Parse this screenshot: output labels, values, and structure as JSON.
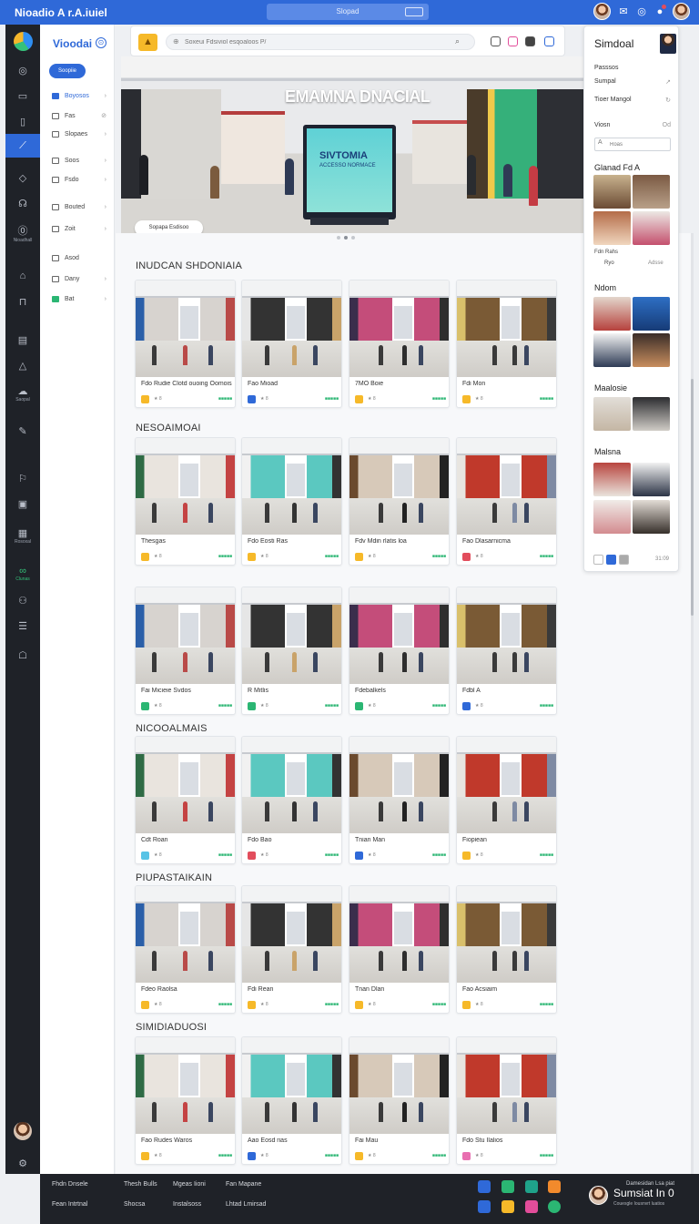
{
  "topbar": {
    "brand": "Nioadio A r.A.iuiel",
    "center_label": "Slopad"
  },
  "nav": {
    "title": "Vioodai",
    "button": "Soopiie",
    "items": [
      {
        "label": "Boyosos",
        "active": true
      },
      {
        "label": "Fas"
      },
      {
        "label": "Slopaes"
      },
      {
        "label": "Soos"
      },
      {
        "label": "Fsdo"
      },
      {
        "label": "Bouted"
      },
      {
        "label": "Zoit"
      },
      {
        "label": "Asod"
      },
      {
        "label": "Dany"
      },
      {
        "label": "Bat"
      }
    ]
  },
  "rail": {
    "labels": [
      "Nioadhall",
      "Saopal",
      "Rosoxal",
      "Clunas"
    ]
  },
  "search": {
    "placeholder": "Soxeui Fdsiviol esqoaloos P/"
  },
  "hero": {
    "headline": "EMAMNA DNACIAL",
    "kiosk_title": "SIVTOMIA",
    "kiosk_sub": "ACCESSO NORMACE",
    "pill": "Sopapa Esdisoo"
  },
  "sections": [
    {
      "title": "INUDCAN SHDONIAIA",
      "cards": [
        {
          "caption": "Fdo Rudie Clotd ouoing Oomoiss",
          "badge": "#f6b929"
        },
        {
          "caption": "Fao Mioad",
          "badge": "#2f69d8"
        },
        {
          "caption": "7MO Boie",
          "badge": "#f6b929"
        },
        {
          "caption": "Fdi Mon",
          "badge": "#f6b929"
        }
      ]
    },
    {
      "title": "NESOAIMOAI",
      "cards": [
        {
          "caption": "Thesgas",
          "badge": "#f6b929"
        },
        {
          "caption": "Fdo Eosti Ras",
          "badge": "#f6b929"
        },
        {
          "caption": "Fdv Mdin rlatis loa",
          "badge": "#f6b929"
        },
        {
          "caption": "Fao Dlasarnicma",
          "badge": "#e24d5c"
        }
      ]
    },
    {
      "title": "",
      "cards": [
        {
          "caption": "Fai Micieie Svdos",
          "badge": "#2bb673"
        },
        {
          "caption": "R Mitlis",
          "badge": "#2bb673"
        },
        {
          "caption": "Fdebalkels",
          "badge": "#2bb673"
        },
        {
          "caption": "Fdbl A",
          "badge": "#2f69d8"
        }
      ]
    },
    {
      "title": "NICOOALMAIS",
      "cards": [
        {
          "caption": "Cdt Roan",
          "badge": "#58c3e6"
        },
        {
          "caption": "Fdo Bao",
          "badge": "#e24d5c"
        },
        {
          "caption": "Tnian Man",
          "badge": "#2f69d8"
        },
        {
          "caption": "Fiopiean",
          "badge": "#f6b929"
        }
      ]
    },
    {
      "title": "PIUPASTAIKAIN",
      "cards": [
        {
          "caption": "Fdeo Raolsa",
          "badge": "#f6b929"
        },
        {
          "caption": "Fdi Rean",
          "badge": "#f6b929"
        },
        {
          "caption": "Tnan Dlan",
          "badge": "#f6b929"
        },
        {
          "caption": "Fao Acsiaim",
          "badge": "#f6b929"
        }
      ]
    },
    {
      "title": "SIMIDIADUOSI",
      "cards": [
        {
          "caption": "Fao Rudes Waros",
          "badge": "#f6b929"
        },
        {
          "caption": "Aao Eosd rias",
          "badge": "#2f69d8"
        },
        {
          "caption": "Fai Mau",
          "badge": "#f6b929"
        },
        {
          "caption": "Fdo Stu Ilalios",
          "badge": "#e86fb0"
        }
      ]
    }
  ],
  "right_panel": {
    "title": "Simdoal",
    "rows": [
      {
        "label": "Passsos",
        "right": ""
      },
      {
        "label": "Sumpal",
        "right": "↗"
      },
      {
        "label": "Tioer Mangol",
        "right": "↻"
      },
      {
        "label": "Viosn",
        "right": "Od"
      }
    ],
    "input_placeholder": "Roas",
    "sections": [
      "Glanad Fd A",
      "Ndom",
      "Maalosie",
      "Malsna"
    ],
    "small_labels": [
      "Fdn Rahs",
      "Ryo",
      "Adsse"
    ],
    "page": "31:09"
  },
  "footer": {
    "col1": [
      "Fhdn Dnsele",
      "Fean Intrtnal"
    ],
    "col2": [
      "Thesh Bulls",
      "Shocsa"
    ],
    "col3": [
      "Mgeas Iioni",
      "Instalsoss"
    ],
    "col4": [
      "Fan Mapane",
      "Lhtad Lmirsad"
    ],
    "name": "Sumsiat In 0",
    "sub": "Couesgle Iousnvrt luatios",
    "corner": "Damesidan Lsa piat"
  },
  "colors": {
    "accent": "#2f69d8",
    "rail": "#1f2228",
    "green": "#2bb673",
    "yellow": "#f6b929"
  }
}
